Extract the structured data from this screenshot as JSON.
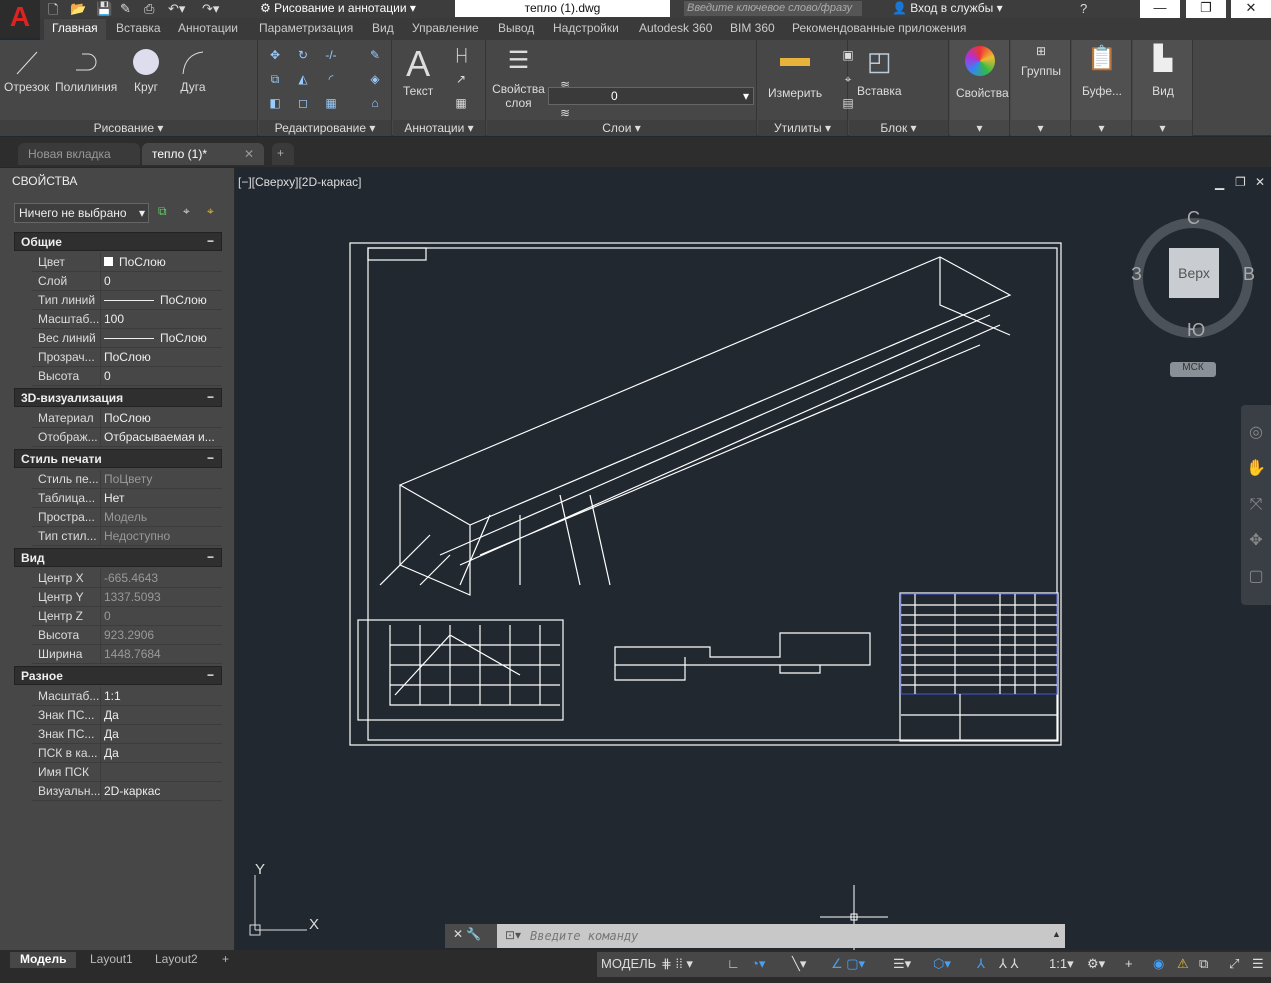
{
  "app": {
    "workspace": "Рисование и аннотации",
    "document_title": "тепло (1).dwg",
    "search_placeholder": "Введите ключевое слово/фразу",
    "login": "Вход в службы",
    "accent": "#d92b2b"
  },
  "ribbon_tabs": [
    "Главная",
    "Вставка",
    "Аннотации",
    "Параметризация",
    "Вид",
    "Управление",
    "Вывод",
    "Надстройки",
    "Autodesk 360",
    "BIM 360",
    "Рекомендованные приложения"
  ],
  "panels": {
    "draw": {
      "label": "Рисование",
      "tools": [
        "Отрезок",
        "Полилиния",
        "Круг",
        "Дуга"
      ]
    },
    "modify": {
      "label": "Редактирование"
    },
    "annot": {
      "label": "Аннотации",
      "tools": [
        "Текст"
      ]
    },
    "layers": {
      "label": "Слои",
      "tools": [
        "Свойства слоя"
      ],
      "current_layer": "0"
    },
    "utils": {
      "label": "Утилиты",
      "tools": [
        "Измерить"
      ]
    },
    "block": {
      "label": "Блок",
      "tools": [
        "Вставка"
      ]
    },
    "props": {
      "label": "Свойства"
    },
    "groups": {
      "label": "Группы"
    },
    "clip": {
      "label": "Буфе..."
    },
    "view": {
      "label": "Вид"
    }
  },
  "doc_tabs": [
    "Новая вкладка",
    "тепло (1)*"
  ],
  "properties": {
    "title": "СВОЙСТВА",
    "selection": "Ничего не выбрано",
    "sections": [
      {
        "name": "Общие",
        "rows": [
          [
            "Цвет",
            "ПоСлою"
          ],
          [
            "Слой",
            "0"
          ],
          [
            "Тип линий",
            "ПоСлою"
          ],
          [
            "Масштаб...",
            "100"
          ],
          [
            "Вес линий",
            "ПоСлою"
          ],
          [
            "Прозрач...",
            "ПоСлою"
          ],
          [
            "Высота",
            "0"
          ]
        ]
      },
      {
        "name": "3D-визуализация",
        "rows": [
          [
            "Материал",
            "ПоСлою"
          ],
          [
            "Отображ...",
            "Отбрасываемая  и..."
          ]
        ]
      },
      {
        "name": "Стиль печати",
        "rows": [
          [
            "Стиль  пе...",
            "ПоЦвету"
          ],
          [
            "Таблица...",
            "Нет"
          ],
          [
            "Простра...",
            "Модель"
          ],
          [
            "Тип стил...",
            "Недоступно"
          ]
        ]
      },
      {
        "name": "Вид",
        "rows": [
          [
            "Центр X",
            "-665.4643"
          ],
          [
            "Центр Y",
            "1337.5093"
          ],
          [
            "Центр Z",
            "0"
          ],
          [
            "Высота",
            "923.2906"
          ],
          [
            "Ширина",
            "1448.7684"
          ]
        ]
      },
      {
        "name": "Разное",
        "rows": [
          [
            "Масштаб...",
            "1:1"
          ],
          [
            "Знак ПС...",
            "Да"
          ],
          [
            "Знак ПС...",
            "Да"
          ],
          [
            "ПСК в ка...",
            "Да"
          ],
          [
            "Имя ПСК",
            ""
          ],
          [
            "Визуальн...",
            "2D-каркас"
          ]
        ]
      }
    ]
  },
  "viewport": {
    "label": "[−][Сверху][2D-каркас]",
    "navcube": {
      "face": "Верх",
      "n": "С",
      "s": "Ю",
      "w": "З",
      "e": "В",
      "ucs": "МСК"
    },
    "ucs_x": "X",
    "ucs_y": "Y"
  },
  "command": {
    "placeholder": "Введите команду"
  },
  "layout_tabs": [
    "Модель",
    "Layout1",
    "Layout2"
  ],
  "status": {
    "model": "МОДЕЛЬ",
    "scale": "1:1"
  }
}
